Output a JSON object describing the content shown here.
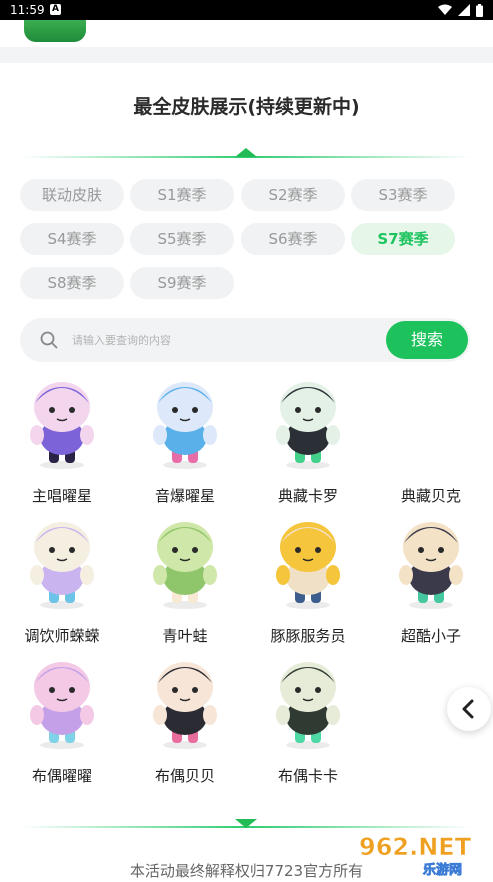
{
  "status_bar": {
    "time": "11:59",
    "app_badge": "A"
  },
  "section": {
    "title": "最全皮肤展示(持续更新中)"
  },
  "tabs": [
    {
      "label": "联动皮肤",
      "active": false
    },
    {
      "label": "S1赛季",
      "active": false
    },
    {
      "label": "S2赛季",
      "active": false
    },
    {
      "label": "S3赛季",
      "active": false
    },
    {
      "label": "S4赛季",
      "active": false
    },
    {
      "label": "S5赛季",
      "active": false
    },
    {
      "label": "S6赛季",
      "active": false
    },
    {
      "label": "S7赛季",
      "active": true
    },
    {
      "label": "S8赛季",
      "active": false
    },
    {
      "label": "S9赛季",
      "active": false
    }
  ],
  "search": {
    "placeholder": "请输入要查询的内容",
    "button_label": "搜索"
  },
  "skins": [
    {
      "name": "主唱曜星",
      "colors": [
        "#f3d6ee",
        "#7c63d8",
        "#2a2345"
      ]
    },
    {
      "name": "音爆曜星",
      "colors": [
        "#dde9fb",
        "#5ab0e9",
        "#e86ca8"
      ]
    },
    {
      "name": "典藏卡罗",
      "colors": [
        "#e4f1e6",
        "#2b2f36",
        "#44d08a"
      ]
    },
    {
      "name": "典藏贝克",
      "colors": [
        "#ffffff",
        "#ffffff",
        "#ffffff"
      ]
    },
    {
      "name": "调饮师蝾蝾",
      "colors": [
        "#f5efe2",
        "#c9b4f0",
        "#6cc3e8"
      ]
    },
    {
      "name": "青叶蛙",
      "colors": [
        "#cfe7a8",
        "#8fc56b",
        "#f7e9d3"
      ]
    },
    {
      "name": "豚豚服务员",
      "colors": [
        "#f5c53b",
        "#f0e0c6",
        "#3d5d8c"
      ]
    },
    {
      "name": "超酷小子",
      "colors": [
        "#f3e2c6",
        "#3a3a4a",
        "#45c7a0"
      ]
    },
    {
      "name": "布偶曜曜",
      "colors": [
        "#f3c9e6",
        "#c3a0e8",
        "#7fd3e8"
      ]
    },
    {
      "name": "布偶贝贝",
      "colors": [
        "#f7e6d8",
        "#2b2b33",
        "#e86c9c"
      ]
    },
    {
      "name": "布偶卡卡",
      "colors": [
        "#e6ecd8",
        "#2f3a33",
        "#4fd7a4"
      ]
    }
  ],
  "footer": {
    "text": "本活动最终解释权归7723官方所有"
  },
  "watermark": {
    "brand": "962.NET",
    "sub": "乐游网"
  },
  "accent_color": "#1dc25c"
}
